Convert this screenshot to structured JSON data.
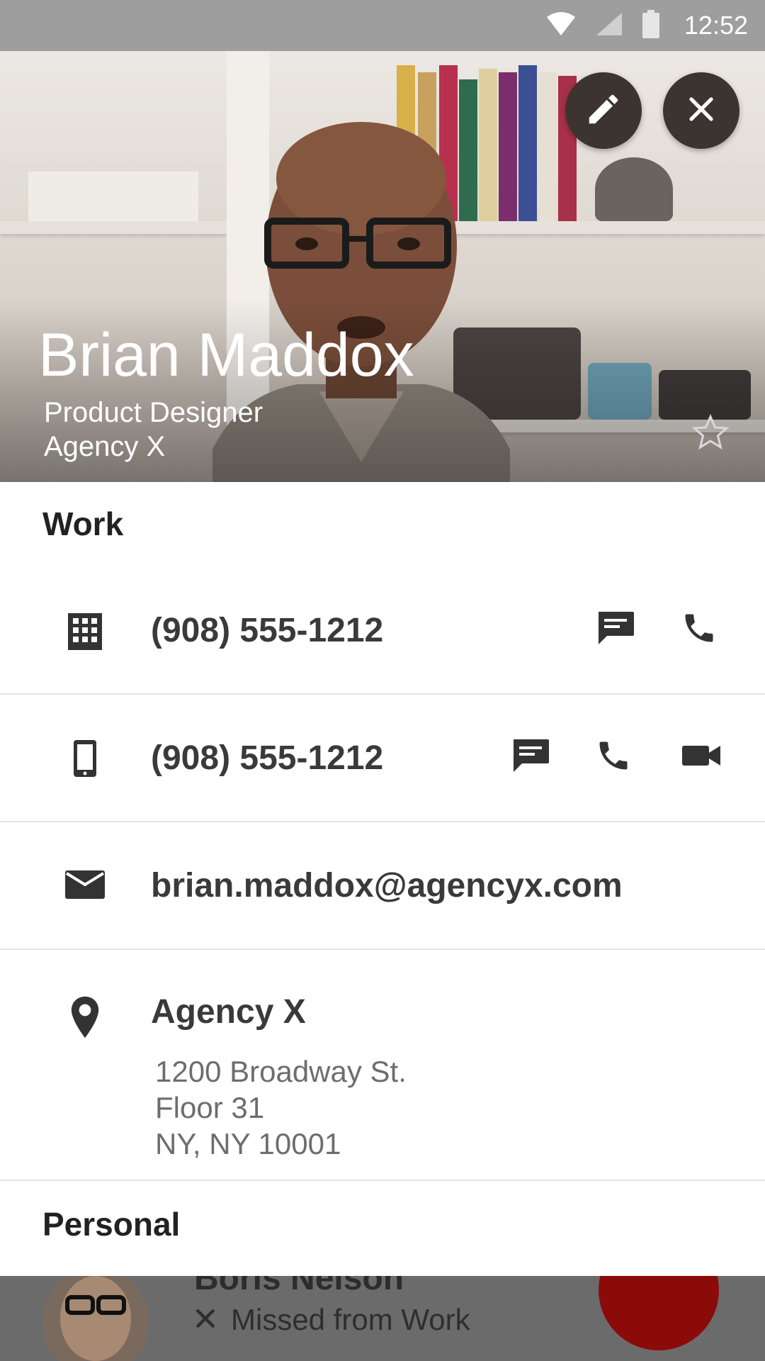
{
  "status_bar": {
    "time": "12:52"
  },
  "contact": {
    "name": "Brian Maddox",
    "title": "Product Designer",
    "company": "Agency X"
  },
  "sections": {
    "work_label": "Work",
    "personal_label": "Personal"
  },
  "work": {
    "office_phone": "(908) 555-1212",
    "mobile_phone": "(908) 555-1212",
    "email": "brian.maddox@agencyx.com",
    "address": {
      "name": "Agency X",
      "line1": "1200 Broadway St.",
      "line2": "Floor 31",
      "line3": "NY, NY 10001"
    }
  },
  "background_list": {
    "name": "Boris Nelson",
    "status": "Missed from Work"
  },
  "colors": {
    "status_bar": "#9e9e9e",
    "fab_dark": "#3b3430",
    "accent_red": "#8b0a0a",
    "divider": "#e3e3e3"
  },
  "icons": [
    "wifi-icon",
    "signal-icon",
    "battery-icon",
    "edit-icon",
    "close-icon",
    "star-icon",
    "building-icon",
    "message-icon",
    "phone-icon",
    "mobile-icon",
    "video-icon",
    "email-icon",
    "location-icon",
    "missed-call-icon"
  ]
}
